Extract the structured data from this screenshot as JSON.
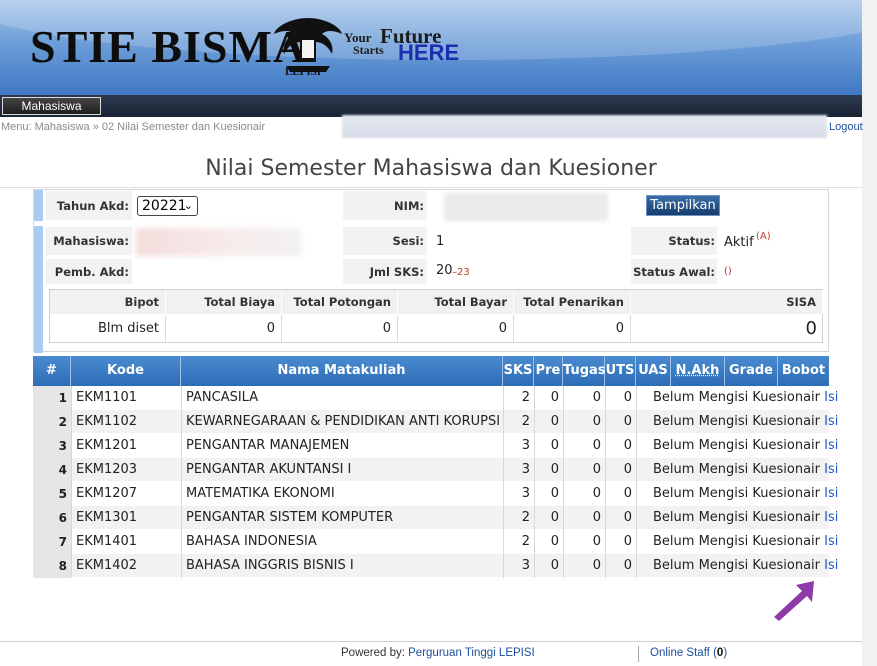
{
  "header": {
    "brand": "STIE BISMA",
    "emblem_label": "LEPISI",
    "tagline_your": "Your",
    "tagline_future": "Future",
    "tagline_starts": "Starts",
    "tagline_here": "HERE"
  },
  "nav": {
    "tab_label": "Mahasiswa",
    "breadcrumb": "Menu: Mahasiswa » 02 Nilai Semester dan Kuesionair",
    "logout_label": "Logout"
  },
  "page_title": "Nilai Semester Mahasiswa dan Kuesioner",
  "filter": {
    "tahun_label": "Tahun Akd:",
    "tahun_value": "20221",
    "nim_label": "NIM:",
    "show_button": "Tampilkan"
  },
  "student": {
    "mahasiswa_label": "Mahasiswa:",
    "sesi_label": "Sesi:",
    "sesi_value": "1",
    "status_label": "Status:",
    "status_value": "Aktif",
    "status_code": "(A)",
    "pemb_label": "Pemb. Akd:",
    "jml_sks_label": "Jml SKS:",
    "jml_sks_value": "20",
    "jml_sks_max": "–23",
    "status_awal_label": "Status Awal:",
    "status_awal_value": "()"
  },
  "payment": {
    "headers": [
      "Bipot",
      "Total Biaya",
      "Total Potongan",
      "Total Bayar",
      "Total Penarikan",
      "SISA"
    ],
    "values": [
      "Blm diset",
      "0",
      "0",
      "0",
      "0",
      "0"
    ]
  },
  "grades": {
    "headers": [
      "#",
      "Kode",
      "Nama Matakuliah",
      "SKS",
      "Pre",
      "Tugas",
      "UTS",
      "UAS",
      "N.Akh",
      "Grade",
      "Bobot"
    ],
    "rows": [
      {
        "no": "1",
        "kode": "EKM1101",
        "nama": "PANCASILA",
        "sks": "2",
        "pre": "0",
        "tugas": "0",
        "uts": "0",
        "note": "Belum Mengisi Kuesionair",
        "link": "Isi"
      },
      {
        "no": "2",
        "kode": "EKM1102",
        "nama": "KEWARNEGARAAN & PENDIDIKAN ANTI KORUPSI",
        "sks": "2",
        "pre": "0",
        "tugas": "0",
        "uts": "0",
        "note": "Belum Mengisi Kuesionair",
        "link": "Isi"
      },
      {
        "no": "3",
        "kode": "EKM1201",
        "nama": "PENGANTAR MANAJEMEN",
        "sks": "3",
        "pre": "0",
        "tugas": "0",
        "uts": "0",
        "note": "Belum Mengisi Kuesionair",
        "link": "Isi"
      },
      {
        "no": "4",
        "kode": "EKM1203",
        "nama": "PENGANTAR AKUNTANSI I",
        "sks": "3",
        "pre": "0",
        "tugas": "0",
        "uts": "0",
        "note": "Belum Mengisi Kuesionair",
        "link": "Isi"
      },
      {
        "no": "5",
        "kode": "EKM1207",
        "nama": "MATEMATIKA EKONOMI",
        "sks": "3",
        "pre": "0",
        "tugas": "0",
        "uts": "0",
        "note": "Belum Mengisi Kuesionair",
        "link": "Isi"
      },
      {
        "no": "6",
        "kode": "EKM1301",
        "nama": "PENGANTAR SISTEM KOMPUTER",
        "sks": "2",
        "pre": "0",
        "tugas": "0",
        "uts": "0",
        "note": "Belum Mengisi Kuesionair",
        "link": "Isi"
      },
      {
        "no": "7",
        "kode": "EKM1401",
        "nama": "BAHASA INDONESIA",
        "sks": "2",
        "pre": "0",
        "tugas": "0",
        "uts": "0",
        "note": "Belum Mengisi Kuesionair",
        "link": "Isi"
      },
      {
        "no": "8",
        "kode": "EKM1402",
        "nama": "BAHASA INGGRIS BISNIS I",
        "sks": "3",
        "pre": "0",
        "tugas": "0",
        "uts": "0",
        "note": "Belum Mengisi Kuesionair",
        "link": "Isi"
      }
    ]
  },
  "footer": {
    "powered_by": "Powered by:",
    "powered_link": "Perguruan Tinggi LEPISI",
    "online_staff": "Online Staff (",
    "online_count": "0",
    "online_close": ")"
  },
  "colors": {
    "header_blue": "#3f78c4",
    "table_header": "#2d6db6",
    "link": "#1d5fb4",
    "accent_arrow": "#8e3aa8"
  },
  "icons": [
    "emblem-logo-icon",
    "select-arrow-icon",
    "pointer-arrow-icon"
  ]
}
